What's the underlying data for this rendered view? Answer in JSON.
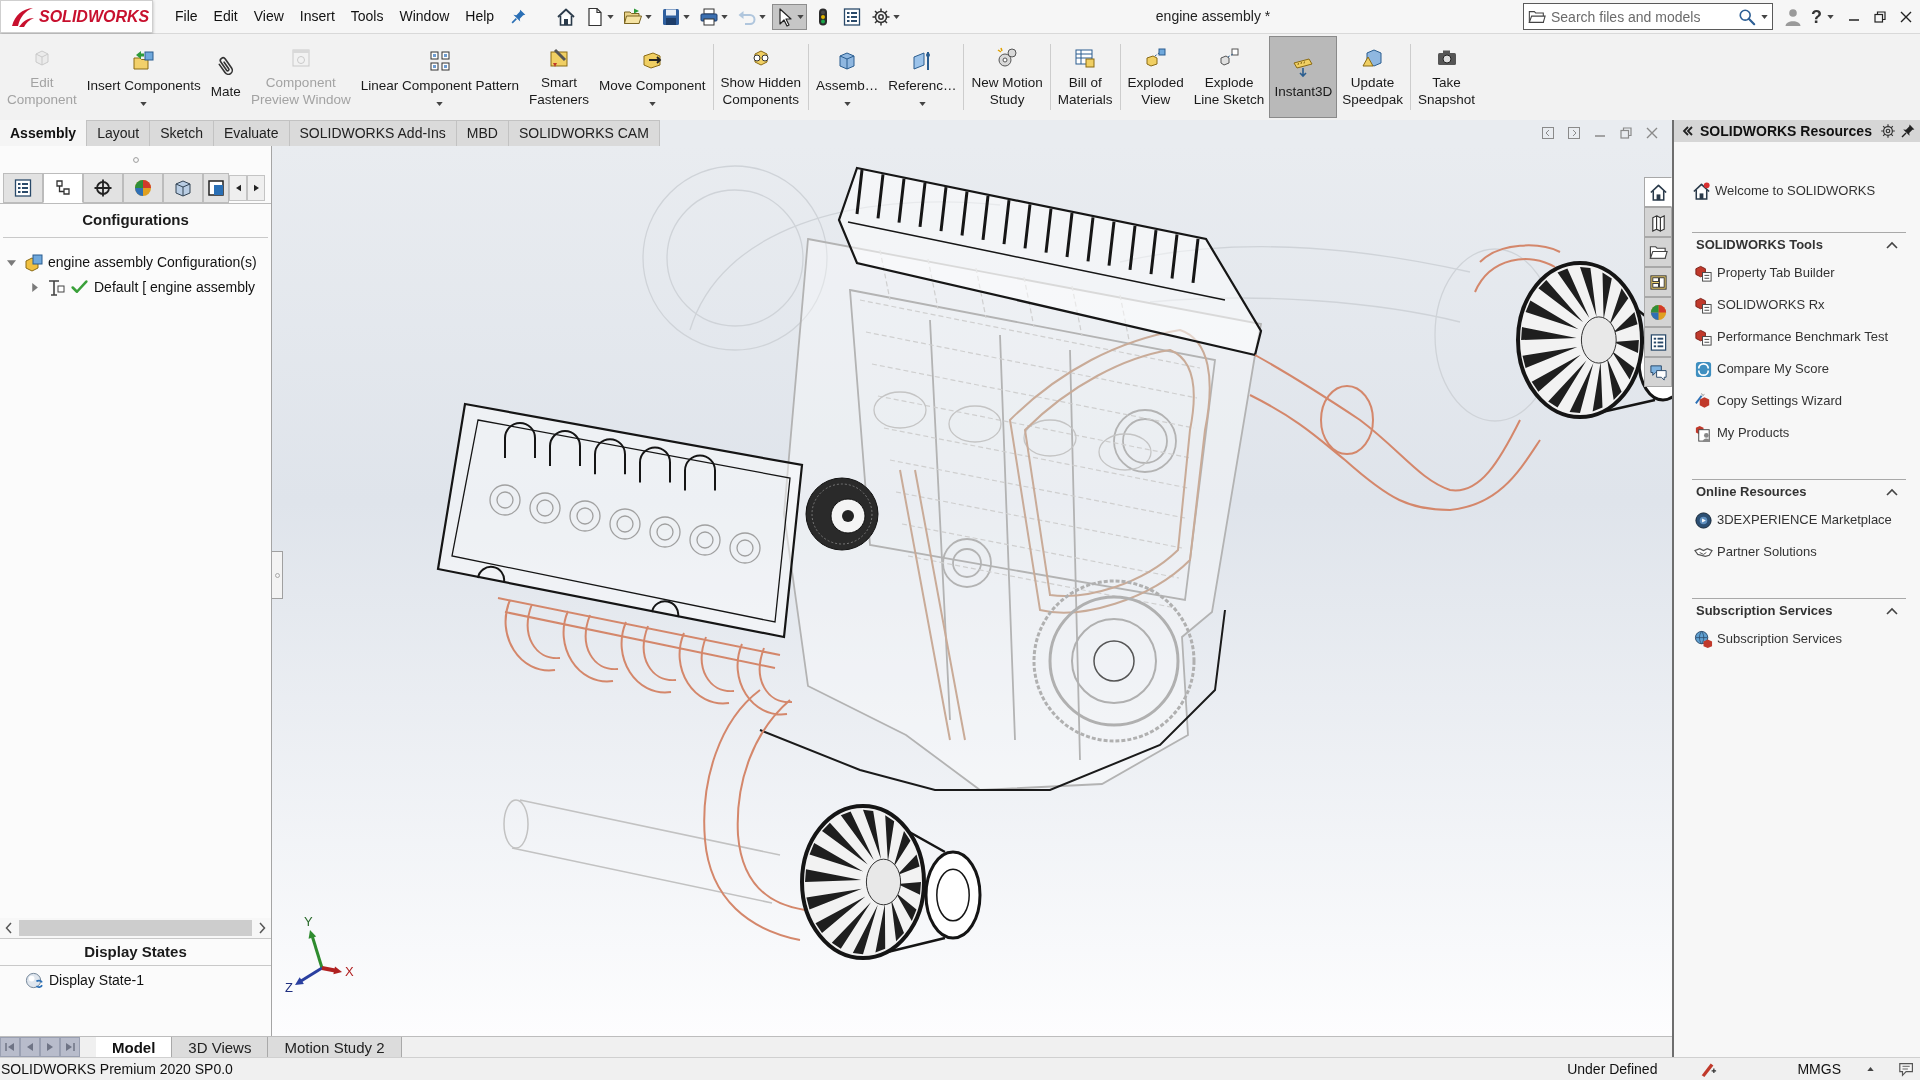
{
  "title_bar": {
    "logo_text": "SOLIDWORKS",
    "menu": [
      "File",
      "Edit",
      "View",
      "Insert",
      "Tools",
      "Window",
      "Help"
    ],
    "document_title": "engine assembly *",
    "search": {
      "placeholder": "Search files and models"
    },
    "help": "?"
  },
  "quick_access": [
    {
      "dropdown": false,
      "disabled": false,
      "pressed": false
    },
    {
      "dropdown": true,
      "disabled": false,
      "pressed": false
    },
    {
      "dropdown": true,
      "disabled": false,
      "pressed": false
    },
    {
      "dropdown": true,
      "disabled": false,
      "pressed": false
    },
    {
      "dropdown": true,
      "disabled": false,
      "pressed": false
    },
    {
      "dropdown": true,
      "disabled": true,
      "pressed": false
    },
    {
      "dropdown": true,
      "disabled": false,
      "pressed": true
    },
    {
      "dropdown": false,
      "disabled": false,
      "pressed": false
    },
    {
      "dropdown": false,
      "disabled": false,
      "pressed": false
    },
    {
      "dropdown": true,
      "disabled": false,
      "pressed": false
    }
  ],
  "command_manager": {
    "groups": [
      [
        {
          "label": "Edit\nComponent",
          "disabled": true,
          "pressed": false,
          "dropdown": false
        },
        {
          "label": "Insert Components",
          "disabled": false,
          "pressed": false,
          "dropdown": true
        },
        {
          "label": "Mate",
          "disabled": false,
          "pressed": false,
          "dropdown": false
        },
        {
          "label": "Component\nPreview Window",
          "disabled": true,
          "pressed": false,
          "dropdown": false
        },
        {
          "label": "Linear Component Pattern",
          "disabled": false,
          "pressed": false,
          "dropdown": true
        },
        {
          "label": "Smart\nFasteners",
          "disabled": false,
          "pressed": false,
          "dropdown": false
        },
        {
          "label": "Move Component",
          "disabled": false,
          "pressed": false,
          "dropdown": true
        }
      ],
      [
        {
          "label": "Show Hidden\nComponents",
          "disabled": false,
          "pressed": false,
          "dropdown": false
        }
      ],
      [
        {
          "label": "Assemb…",
          "disabled": false,
          "pressed": false,
          "dropdown": true
        },
        {
          "label": "Referenc…",
          "disabled": false,
          "pressed": false,
          "dropdown": true
        }
      ],
      [
        {
          "label": "New Motion\nStudy",
          "disabled": false,
          "pressed": false,
          "dropdown": false
        }
      ],
      [
        {
          "label": "Bill of\nMaterials",
          "disabled": false,
          "pressed": false,
          "dropdown": false
        }
      ],
      [
        {
          "label": "Exploded\nView",
          "disabled": false,
          "pressed": false,
          "dropdown": false
        },
        {
          "label": "Explode\nLine Sketch",
          "disabled": false,
          "pressed": false,
          "dropdown": false
        },
        {
          "label": "Instant3D",
          "disabled": false,
          "pressed": true,
          "dropdown": false
        },
        {
          "label": "Update\nSpeedpak",
          "disabled": false,
          "pressed": false,
          "dropdown": false
        }
      ],
      [
        {
          "label": "Take\nSnapshot",
          "disabled": false,
          "pressed": false,
          "dropdown": false
        }
      ]
    ]
  },
  "command_tabs": [
    {
      "label": "Assembly",
      "selected": true
    },
    {
      "label": "Layout",
      "selected": false
    },
    {
      "label": "Sketch",
      "selected": false
    },
    {
      "label": "Evaluate",
      "selected": false
    },
    {
      "label": "SOLIDWORKS Add-Ins",
      "selected": false
    },
    {
      "label": "MBD",
      "selected": false
    },
    {
      "label": "SOLIDWORKS CAM",
      "selected": false
    }
  ],
  "feature_manager": {
    "tabs": [
      {
        "selected": false
      },
      {
        "selected": true
      },
      {
        "selected": false
      },
      {
        "selected": false
      },
      {
        "selected": false
      },
      {
        "selected": false
      }
    ],
    "configurations": {
      "title": "Configurations",
      "tree": [
        {
          "label": "engine assembly Configuration(s)",
          "expanded": true,
          "active": false,
          "children": [
            {
              "label": "Default [ engine assembly",
              "expanded": false,
              "active": true
            }
          ]
        }
      ]
    },
    "display_states": {
      "title": "Display States",
      "items": [
        "Display State-1"
      ]
    }
  },
  "viewport": {
    "triad_labels": [
      "Y",
      "X",
      "Z"
    ]
  },
  "task_pane": {
    "title": "SOLIDWORKS Resources",
    "tabs": [
      {
        "selected": true
      },
      {
        "selected": false
      },
      {
        "selected": false
      },
      {
        "selected": false
      },
      {
        "selected": false
      },
      {
        "selected": false
      },
      {
        "selected": false
      }
    ],
    "welcome": "Welcome to SOLIDWORKS",
    "sections": [
      {
        "title": "SOLIDWORKS Tools",
        "expanded": true,
        "items": [
          "Property Tab Builder",
          "SOLIDWORKS Rx",
          "Performance Benchmark Test",
          "Compare My Score",
          "Copy Settings Wizard",
          "My Products"
        ]
      },
      {
        "title": "Online Resources",
        "expanded": true,
        "items": [
          "3DEXPERIENCE Marketplace",
          "Partner Solutions"
        ]
      },
      {
        "title": "Subscription Services",
        "expanded": true,
        "items": [
          "Subscription Services"
        ]
      }
    ]
  },
  "bottom_tabs": [
    {
      "label": "Model",
      "selected": true
    },
    {
      "label": "3D Views",
      "selected": false
    },
    {
      "label": "Motion Study 2",
      "selected": false
    }
  ],
  "status_bar": {
    "version": "SOLIDWORKS Premium 2020 SP0.0",
    "state": "Under Defined",
    "units": "MMGS"
  }
}
